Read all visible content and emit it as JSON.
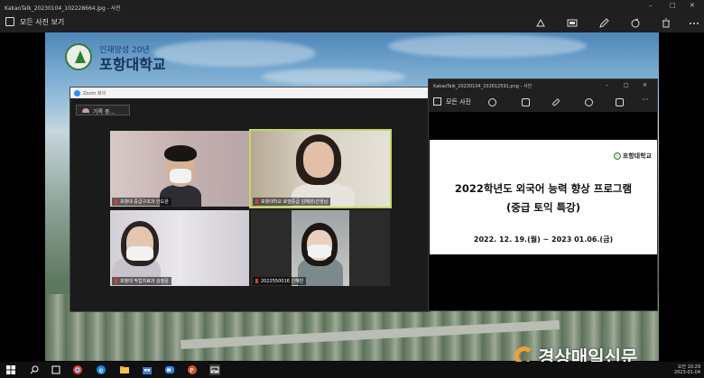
{
  "outer_window": {
    "title": "KakaoTalk_20230104_102228664.jpg - 사진",
    "toolbar_all_photos": "모든 사진 보기",
    "window_controls": [
      "–",
      "□",
      "✕"
    ],
    "toolbar_icons": [
      "enhance-icon",
      "video-icon",
      "edit-icon",
      "rotate-icon",
      "delete-icon",
      "more-icon"
    ]
  },
  "background_photo": {
    "university_tagline": "인재양성 20년",
    "university_name": "포항대학교"
  },
  "zoom": {
    "title": "Zoom 회의",
    "recording_label": "기록 중...",
    "participants": [
      {
        "label": "포항대 중급구조과 안도완"
      },
      {
        "label": "포항대학교 호텔중급 김혜원(선생님"
      },
      {
        "label": "포항대 작업치료과 김정윤"
      },
      {
        "label": "2022550016 신혜빈"
      }
    ]
  },
  "inner_window": {
    "title": "KakaoTalk_20230104_102612591.png - 사진",
    "toolbar_all_photos": "모든 사진",
    "window_controls": [
      "–",
      "□",
      "✕"
    ],
    "slide": {
      "logo_text": "포항대학교",
      "title_line1": "2022학년도 외국어 능력 향상 프로그램",
      "title_line2": "(중급 토익 특강)",
      "date_range": "2022. 12. 19.(월) ~ 2023 01.06.(금)"
    }
  },
  "watermark": {
    "text": "경상매일신문"
  },
  "taskbar": {
    "clock_time": "오전 10:29",
    "clock_date": "2023-01-04",
    "apps": [
      "start-icon",
      "search-icon",
      "task-view-icon",
      "chrome-icon",
      "edge-icon",
      "file-explorer-icon",
      "store-icon",
      "zoom-icon",
      "powerpoint-icon",
      "photos-icon"
    ]
  }
}
